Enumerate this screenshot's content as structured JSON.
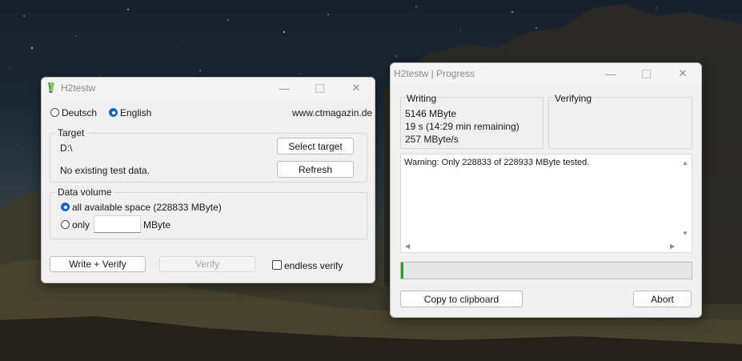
{
  "main_window": {
    "title": "H2testw",
    "lang_deutsch": "Deutsch",
    "lang_english": "English",
    "website": "www.ctmagazin.de",
    "target_group_label": "Target",
    "target_path": "D:\\",
    "select_target_label": "Select target",
    "test_data_status": "No existing test data.",
    "refresh_label": "Refresh",
    "data_volume_label": "Data volume",
    "all_space_label": "all available space (228833 MByte)",
    "only_label": "only",
    "only_value": "",
    "mbyte_unit": "MByte",
    "write_verify_label": "Write + Verify",
    "verify_label": "Verify",
    "endless_verify_label": "endless verify"
  },
  "progress_window": {
    "title": "H2testw | Progress",
    "writing_label": "Writing",
    "writing_amount": "5146 MByte",
    "writing_time": "19 s (14:29 min remaining)",
    "writing_speed": "257 MByte/s",
    "verifying_label": "Verifying",
    "log_text": "Warning: Only 228833 of 228933 MByte tested.",
    "progress_fraction": 0.007,
    "copy_label": "Copy to clipboard",
    "abort_label": "Abort"
  },
  "colors": {
    "accent": "#1f67c1",
    "progress": "#06b025",
    "window_bg": "#f0f0f0"
  },
  "icons": [
    "minimize-icon",
    "maximize-icon",
    "close-icon",
    "h2testw-app-icon",
    "scroll-up-icon",
    "scroll-down-icon",
    "scroll-left-icon",
    "scroll-right-icon"
  ]
}
